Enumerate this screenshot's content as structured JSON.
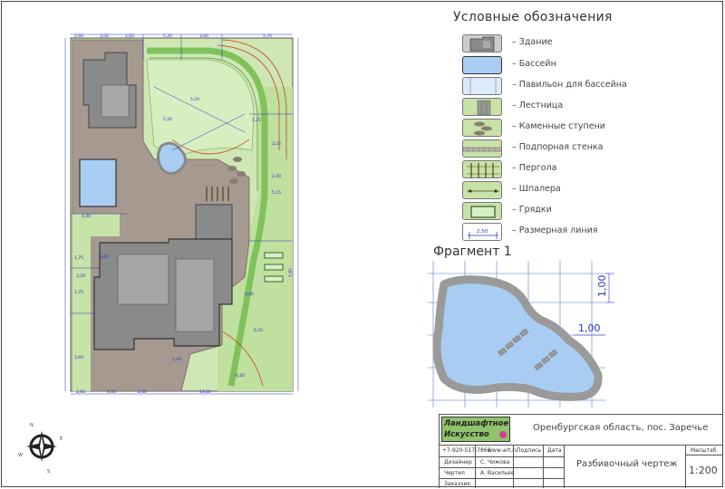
{
  "legend": {
    "title": "Условные обозначения",
    "items": [
      {
        "key": "building",
        "label": "– Здание"
      },
      {
        "key": "pool",
        "label": "– Бассейн"
      },
      {
        "key": "pavilion",
        "label": "– Павильон для бассейна"
      },
      {
        "key": "stairs",
        "label": "– Лестница"
      },
      {
        "key": "stones",
        "label": "– Каменные ступени"
      },
      {
        "key": "wall",
        "label": "– Подпорная стенка"
      },
      {
        "key": "pergola",
        "label": "– Пергола"
      },
      {
        "key": "trellis",
        "label": "– Шпалера"
      },
      {
        "key": "beds",
        "label": "– Грядки"
      },
      {
        "key": "dimension",
        "label": "– Размерная линия"
      }
    ],
    "dimension_value": "2,50"
  },
  "fragment": {
    "title": "Фрагмент 1",
    "dim_vertical": "1,00",
    "dim_horizontal": "1,00"
  },
  "plan": {
    "dimensions": [
      "2,60",
      "3,00",
      "2,60",
      "5,20",
      "3,00",
      "5,70",
      "5,20",
      "5,20",
      "5,25",
      "3,25",
      "2,40",
      "5,15",
      "4,00",
      "1,75",
      "3,20",
      "4,00",
      "1,75",
      "2,60",
      "0,80",
      "6,40",
      "6,20",
      "1,40",
      "2,60",
      "14,60",
      "4,00",
      "2,60",
      "5,80"
    ]
  },
  "titleblock": {
    "logo_line1": "Ландшафтное",
    "logo_line2": "Искусство",
    "phone": "+7-920-517-7866",
    "site": "www-art.ru",
    "col_signature": "Подпись",
    "col_date": "Дата",
    "address": "Оренбургская область, пос. Заречье",
    "designer_role": "Дизайнер",
    "designer_name": "С. Чижова",
    "drafter_role": "Чертил",
    "drafter_name": "А. Васильев",
    "client_role": "Заказчик",
    "drawing_name": "Разбивочный чертеж",
    "scale_header": "Масштаб",
    "scale_value": "1:200"
  },
  "compass": {
    "n": "N",
    "s": "S",
    "e": "E",
    "w": "W"
  },
  "colors": {
    "grass": "#c6e3a8",
    "paving": "#a89b92",
    "building": "#8c8c8c",
    "pool": "#a9cdf2",
    "dimension": "#2233cc",
    "contour": "#cc2a1a",
    "logo": "#8fc46c"
  }
}
